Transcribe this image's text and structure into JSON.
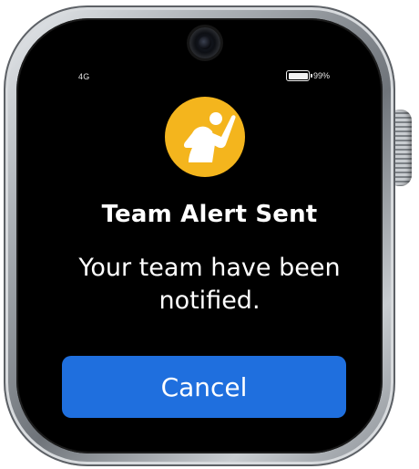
{
  "status_bar": {
    "network": "4G",
    "battery_percent": "99%",
    "battery_level": 0.99
  },
  "alert": {
    "icon": "raised-hand-person-icon",
    "icon_color": "#f4b51d",
    "title": "Team Alert Sent",
    "message": "Your team have been notified."
  },
  "actions": {
    "cancel_label": "Cancel",
    "cancel_color": "#1f6fde"
  }
}
